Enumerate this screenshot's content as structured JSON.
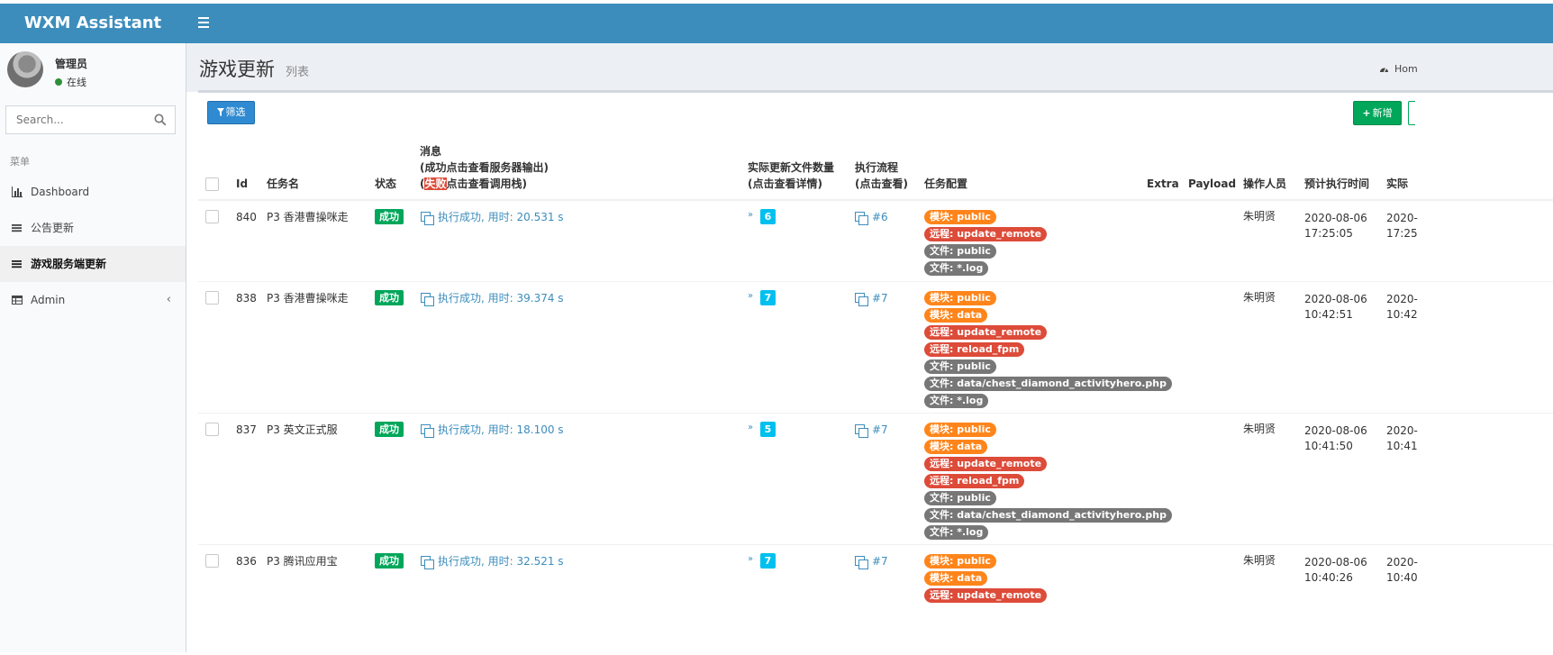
{
  "app": {
    "title": "WXM Assistant"
  },
  "user": {
    "name": "管理员",
    "status": "在线"
  },
  "sidebar": {
    "search_placeholder": "Search...",
    "menu_header": "菜单",
    "items": [
      {
        "label": "Dashboard",
        "icon": "bar-chart-icon"
      },
      {
        "label": "公告更新",
        "icon": "list-icon"
      },
      {
        "label": "游戏服务端更新",
        "icon": "list-icon",
        "active": true
      },
      {
        "label": "Admin",
        "icon": "table-icon",
        "has_submenu": true
      }
    ]
  },
  "page": {
    "title": "游戏更新",
    "subtitle": "列表",
    "breadcrumb": "Hom"
  },
  "toolbar": {
    "filter_label": "筛选",
    "add_label": "新增"
  },
  "table": {
    "headers": {
      "id": "Id",
      "name": "任务名",
      "status": "状态",
      "msg_title": "消息",
      "msg_ok": "(成功点击查看服务器输出)",
      "msg_fail_open": "(",
      "msg_fail_word": "失败",
      "msg_fail_rest": "点击查看调用栈)",
      "files_1": "实际更新文件数量",
      "files_2": "(点击查看详情)",
      "flow_1": "执行流程",
      "flow_2": "(点击查看)",
      "config": "任务配置",
      "extra": "Extra",
      "payload": "Payload",
      "operator": "操作人员",
      "planned": "预计执行时间",
      "actual": "实际"
    },
    "rows": [
      {
        "id": "840",
        "name": "P3 香港曹操咪走",
        "status": "成功",
        "message": "执行成功, 用时: 20.531 s",
        "file_count": "6",
        "flow": "#6",
        "tags": [
          {
            "text": "模块: public",
            "color": "#ff851b"
          },
          {
            "text": "远程: update_remote",
            "color": "#dd4b39"
          },
          {
            "text": "文件: public",
            "color": "#777777"
          },
          {
            "text": "文件: *.log",
            "color": "#777777"
          }
        ],
        "operator": "朱明贤",
        "planned_date": "2020-08-06",
        "planned_time": "17:25:05",
        "actual_date": "2020-",
        "actual_time": "17:25"
      },
      {
        "id": "838",
        "name": "P3 香港曹操咪走",
        "status": "成功",
        "message": "执行成功, 用时: 39.374 s",
        "file_count": "7",
        "flow": "#7",
        "tags": [
          {
            "text": "模块: public",
            "color": "#ff851b"
          },
          {
            "text": "模块: data",
            "color": "#ff851b"
          },
          {
            "text": "远程: update_remote",
            "color": "#dd4b39"
          },
          {
            "text": "远程: reload_fpm",
            "color": "#dd4b39"
          },
          {
            "text": "文件: public",
            "color": "#777777"
          },
          {
            "text": "文件: data/chest_diamond_activityhero.php",
            "color": "#777777"
          },
          {
            "text": "文件: *.log",
            "color": "#777777"
          }
        ],
        "operator": "朱明贤",
        "planned_date": "2020-08-06",
        "planned_time": "10:42:51",
        "actual_date": "2020-",
        "actual_time": "10:42"
      },
      {
        "id": "837",
        "name": "P3 英文正式服",
        "status": "成功",
        "message": "执行成功, 用时: 18.100 s",
        "file_count": "5",
        "flow": "#7",
        "tags": [
          {
            "text": "模块: public",
            "color": "#ff851b"
          },
          {
            "text": "模块: data",
            "color": "#ff851b"
          },
          {
            "text": "远程: update_remote",
            "color": "#dd4b39"
          },
          {
            "text": "远程: reload_fpm",
            "color": "#dd4b39"
          },
          {
            "text": "文件: public",
            "color": "#777777"
          },
          {
            "text": "文件: data/chest_diamond_activityhero.php",
            "color": "#777777"
          },
          {
            "text": "文件: *.log",
            "color": "#777777"
          }
        ],
        "operator": "朱明贤",
        "planned_date": "2020-08-06",
        "planned_time": "10:41:50",
        "actual_date": "2020-",
        "actual_time": "10:41"
      },
      {
        "id": "836",
        "name": "P3 腾讯应用宝",
        "status": "成功",
        "message": "执行成功, 用时: 32.521 s",
        "file_count": "7",
        "flow": "#7",
        "tags": [
          {
            "text": "模块: public",
            "color": "#ff851b"
          },
          {
            "text": "模块: data",
            "color": "#ff851b"
          },
          {
            "text": "远程: update_remote",
            "color": "#dd4b39"
          }
        ],
        "operator": "朱明贤",
        "planned_date": "2020-08-06",
        "planned_time": "10:40:26",
        "actual_date": "2020-",
        "actual_time": "10:40"
      }
    ]
  },
  "colors": {
    "header": "#3c8dbc",
    "success": "#00a65a",
    "info": "#00c0ef",
    "link": "#3c8dbc"
  }
}
